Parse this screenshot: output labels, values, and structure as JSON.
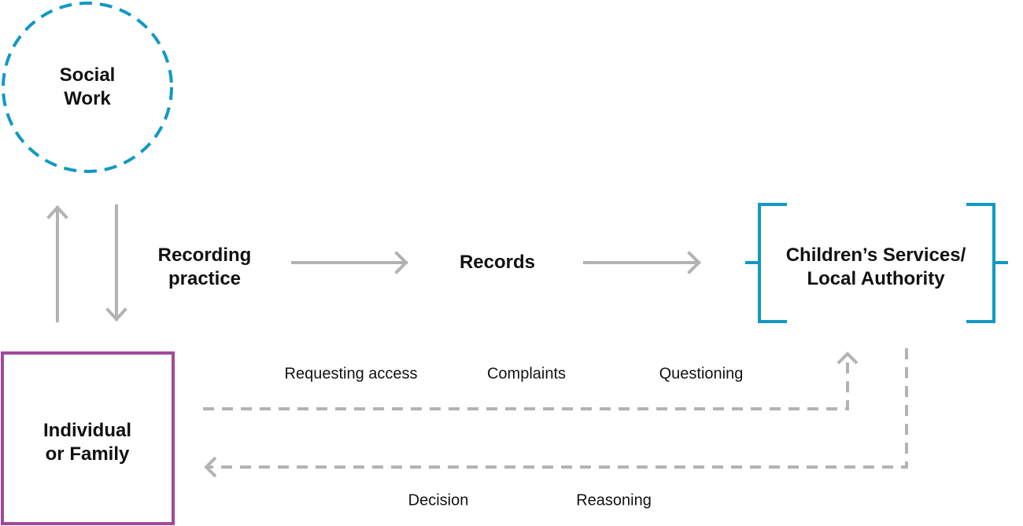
{
  "colors": {
    "social_work": "#1199c3",
    "individual": "#a04a9c",
    "authority": "#1199c3",
    "arrows": "#b3b3b3"
  },
  "nodes": {
    "social_work": [
      "Social",
      "Work"
    ],
    "recording_practice": [
      "Recording",
      "practice"
    ],
    "records": "Records",
    "authority": [
      "Children’s Services/",
      "Local Authority"
    ],
    "individual": [
      "Individual",
      "or Family"
    ]
  },
  "flow_labels": {
    "requesting_access": "Requesting access",
    "complaints": "Complaints",
    "questioning": "Questioning",
    "decision": "Decision",
    "reasoning": "Reasoning"
  }
}
